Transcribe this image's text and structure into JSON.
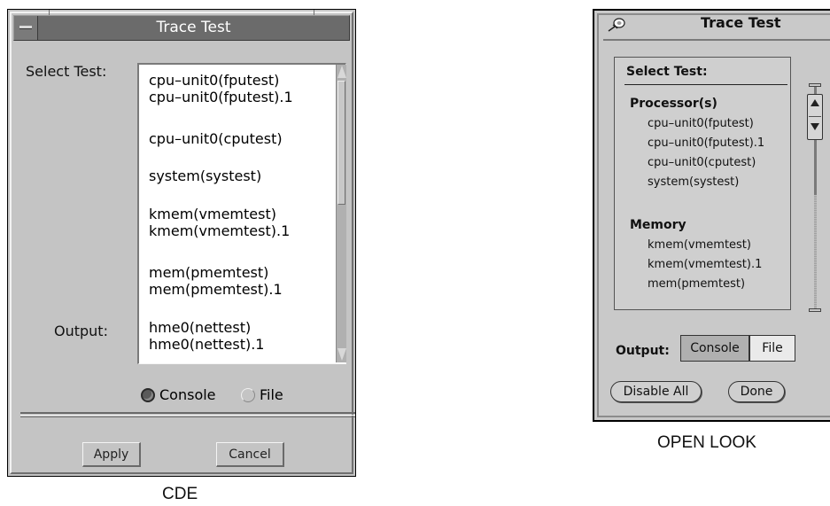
{
  "cde": {
    "window_title": "Trace Test",
    "select_test_label": "Select Test:",
    "output_label": "Output:",
    "tests": [
      "cpu–unit0(fputest)",
      "cpu–unit0(fputest).1",
      "cpu–unit0(cputest)",
      "system(systest)",
      "kmem(vmemtest)",
      "kmem(vmemtest).1",
      "mem(pmemtest)",
      "mem(pmemtest).1",
      "hme0(nettest)",
      "hme0(nettest).1"
    ],
    "output_options": [
      {
        "label": "Console",
        "selected": true
      },
      {
        "label": "File",
        "selected": false
      }
    ],
    "apply_label": "Apply",
    "cancel_label": "Cancel",
    "caption": "CDE"
  },
  "openlook": {
    "window_title": "Trace Test",
    "select_test_label": "Select Test:",
    "groups": [
      {
        "name": "Processor(s)",
        "items": [
          "cpu–unit0(fputest)",
          "cpu–unit0(fputest).1",
          "cpu–unit0(cputest)",
          "system(systest)"
        ]
      },
      {
        "name": "Memory",
        "items": [
          "kmem(vmemtest)",
          "kmem(vmemtest).1",
          "mem(pmemtest)"
        ]
      }
    ],
    "output_label": "Output:",
    "output_options": [
      {
        "label": "Console",
        "selected": true
      },
      {
        "label": "File",
        "selected": false
      }
    ],
    "disable_all_label": "Disable All",
    "done_label": "Done",
    "caption": "OPEN LOOK"
  },
  "colors": {
    "cde_frame": "#c4c4c4",
    "cde_titlebar": "#6b6b6b",
    "openlook_frame": "#c9c9c9"
  }
}
